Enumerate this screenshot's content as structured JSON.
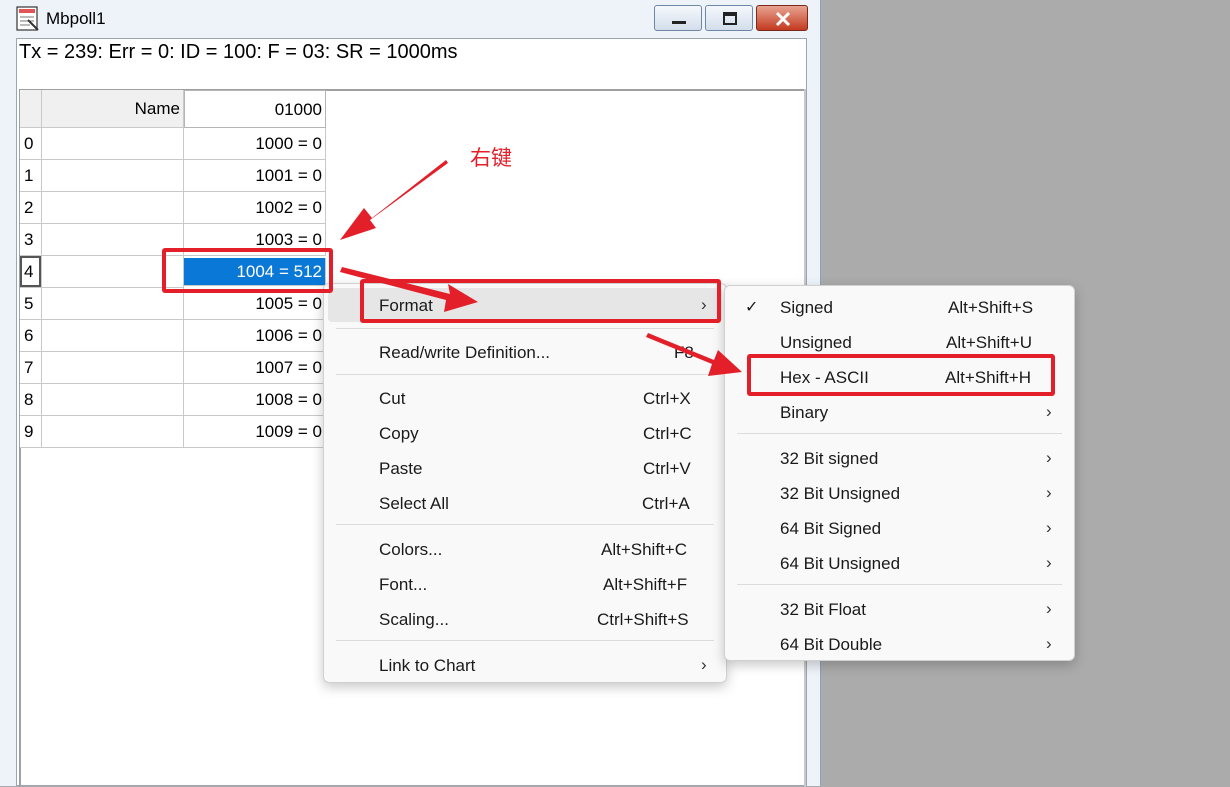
{
  "window": {
    "title": "Mbpoll1",
    "status_line": "Tx = 239: Err = 0: ID = 100: F = 03: SR = 1000ms"
  },
  "grid": {
    "headers": {
      "name": "Name",
      "col": "01000"
    },
    "rows": [
      {
        "index": "0",
        "name": "",
        "value": "1000 = 0"
      },
      {
        "index": "1",
        "name": "",
        "value": "1001 = 0"
      },
      {
        "index": "2",
        "name": "",
        "value": "1002 = 0"
      },
      {
        "index": "3",
        "name": "",
        "value": "1003 = 0"
      },
      {
        "index": "4",
        "name": "",
        "value": "1004 = 512"
      },
      {
        "index": "5",
        "name": "",
        "value": "1005 = 0"
      },
      {
        "index": "6",
        "name": "",
        "value": "1006 = 0"
      },
      {
        "index": "7",
        "name": "",
        "value": "1007 = 0"
      },
      {
        "index": "8",
        "name": "",
        "value": "1008 = 0"
      },
      {
        "index": "9",
        "name": "",
        "value": "1009 = 0"
      }
    ],
    "selected_row": "4"
  },
  "context_menu": {
    "format": {
      "label": "Format",
      "arrow": "›"
    },
    "rw_def": {
      "label": "Read/write Definition...",
      "shortcut": "F8"
    },
    "cut": {
      "label": "Cut",
      "shortcut": "Ctrl+X"
    },
    "copy": {
      "label": "Copy",
      "shortcut": "Ctrl+C"
    },
    "paste": {
      "label": "Paste",
      "shortcut": "Ctrl+V"
    },
    "select_all": {
      "label": "Select All",
      "shortcut": "Ctrl+A"
    },
    "colors": {
      "label": "Colors...",
      "shortcut": "Alt+Shift+C"
    },
    "font": {
      "label": "Font...",
      "shortcut": "Alt+Shift+F"
    },
    "scaling": {
      "label": "Scaling...",
      "shortcut": "Ctrl+Shift+S"
    },
    "link_chart": {
      "label": "Link to Chart",
      "arrow": "›"
    }
  },
  "format_submenu": {
    "signed": {
      "label": "Signed",
      "shortcut": "Alt+Shift+S",
      "checked": true,
      "check": "✓"
    },
    "unsigned": {
      "label": "Unsigned",
      "shortcut": "Alt+Shift+U"
    },
    "hex_ascii": {
      "label": "Hex - ASCII",
      "shortcut": "Alt+Shift+H"
    },
    "binary": {
      "label": "Binary",
      "arrow": "›"
    },
    "bit32_signed": {
      "label": "32 Bit signed",
      "arrow": "›"
    },
    "bit32_unsigned": {
      "label": "32 Bit Unsigned",
      "arrow": "›"
    },
    "bit64_signed": {
      "label": "64 Bit Signed",
      "arrow": "›"
    },
    "bit64_unsigned": {
      "label": "64 Bit Unsigned",
      "arrow": "›"
    },
    "float32": {
      "label": "32 Bit Float",
      "arrow": "›"
    },
    "double64": {
      "label": "64 Bit Double",
      "arrow": "›"
    }
  },
  "annotation": {
    "text": "右键"
  },
  "colors": {
    "highlight": "#e3202a",
    "selection": "#0a78d7"
  },
  "icons": {
    "app": "document-icon",
    "minimize": "minimize-icon",
    "maximize": "maximize-icon",
    "close": "close-icon"
  }
}
